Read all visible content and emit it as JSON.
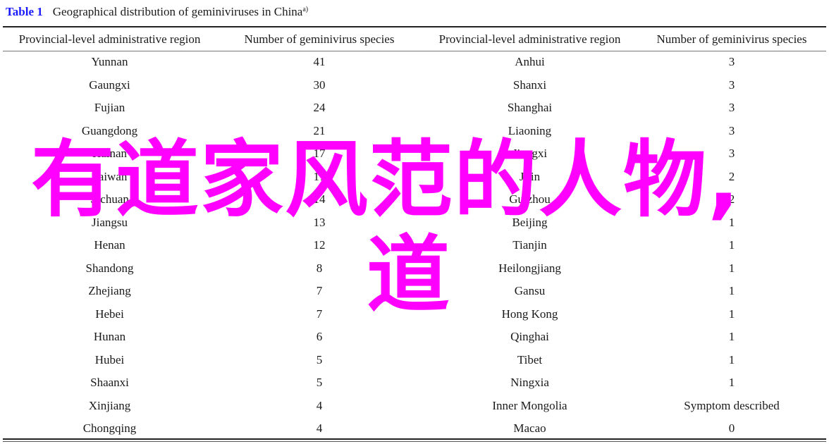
{
  "caption": {
    "label": "Table 1",
    "title": "Geographical distribution of geminiviruses in China",
    "footnote_mark": "a)"
  },
  "accent_color": "#1a1aff",
  "overlay": {
    "line1": "有道家风范的人物,",
    "line2": "道",
    "color": "#ff00ff"
  },
  "headers": [
    "Provincial-level administrative region",
    "Number of geminivirus species",
    "Provincial-level administrative region",
    "Number of geminivirus species"
  ],
  "rows": [
    [
      "Yunnan",
      "41",
      "Anhui",
      "3"
    ],
    [
      "Gaungxi",
      "30",
      "Shanxi",
      "3"
    ],
    [
      "Fujian",
      "24",
      "Shanghai",
      "3"
    ],
    [
      "Guangdong",
      "21",
      "Liaoning",
      "3"
    ],
    [
      "Hainan",
      "17",
      "Jiangxi",
      "3"
    ],
    [
      "Taiwan",
      "17",
      "Jilin",
      "2"
    ],
    [
      "Sichuan",
      "14",
      "Guizhou",
      "2"
    ],
    [
      "Jiangsu",
      "13",
      "Beijing",
      "1"
    ],
    [
      "Henan",
      "12",
      "Tianjin",
      "1"
    ],
    [
      "Shandong",
      "8",
      "Heilongjiang",
      "1"
    ],
    [
      "Zhejiang",
      "7",
      "Gansu",
      "1"
    ],
    [
      "Hebei",
      "7",
      "Hong Kong",
      "1"
    ],
    [
      "Hunan",
      "6",
      "Qinghai",
      "1"
    ],
    [
      "Hubei",
      "5",
      "Tibet",
      "1"
    ],
    [
      "Shaanxi",
      "5",
      "Ningxia",
      "1"
    ],
    [
      "Xinjiang",
      "4",
      "Inner Mongolia",
      "Symptom described"
    ],
    [
      "Chongqing",
      "4",
      "Macao",
      "0"
    ]
  ]
}
